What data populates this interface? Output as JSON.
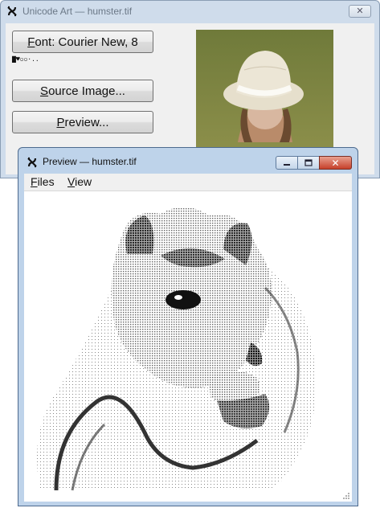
{
  "main_window": {
    "title": "Unicode Art — humster.tif",
    "close_glyph": "✕",
    "font_button": {
      "mnemonic": "F",
      "rest": "ont: Courier New, 8"
    },
    "font_sample": "▇♥▫▫·..",
    "source_button": {
      "mnemonic": "S",
      "rest": "ource Image..."
    },
    "preview_button": {
      "mnemonic": "P",
      "rest": "review..."
    },
    "source_image_icon": "girl-in-straw-hat-photo"
  },
  "preview_window": {
    "title": "Preview — humster.tif",
    "menu": [
      {
        "mnemonic": "F",
        "rest": "iles"
      },
      {
        "mnemonic": "V",
        "rest": "iew"
      }
    ],
    "close_glyph": "✕",
    "art_icon": "hamster-ascii-art"
  },
  "colors": {
    "active_frame": "#bed3ea",
    "inactive_frame": "#cfdceb",
    "close_red": "#c6402a"
  }
}
